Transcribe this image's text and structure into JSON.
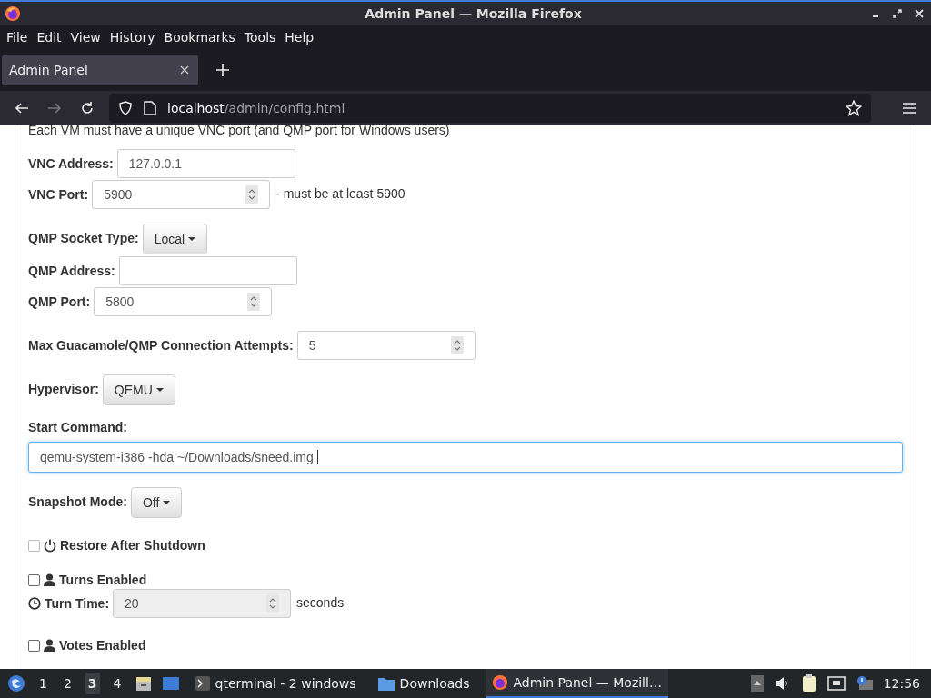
{
  "window": {
    "title": "Admin Panel — Mozilla Firefox"
  },
  "menu": [
    "File",
    "Edit",
    "View",
    "History",
    "Bookmarks",
    "Tools",
    "Help"
  ],
  "tabs": [
    {
      "label": "Admin Panel",
      "selected": true
    }
  ],
  "address": {
    "host": "localhost",
    "path": "/admin/config.html"
  },
  "sections": [
    [
      {
        "kind": "note",
        "text": "Each VM must have a unique VNC port (and QMP port for Windows users)"
      },
      {
        "kind": "text",
        "label": "VNC Address:",
        "value": "127.0.0.1"
      },
      {
        "kind": "number",
        "label": "VNC Port:",
        "value": "5900",
        "suffix": "- must be at least 5900"
      }
    ],
    [
      {
        "kind": "dropdown",
        "label": "QMP Socket Type:",
        "value": "Local"
      },
      {
        "kind": "text",
        "label": "QMP Address:"
      },
      {
        "kind": "number",
        "label": "QMP Port:",
        "value": "5800"
      }
    ],
    [
      {
        "kind": "number",
        "label": "Max Guacamole/QMP Connection Attempts:",
        "value": "5"
      }
    ],
    [
      {
        "kind": "dropdown",
        "label": "Hypervisor:",
        "value": "QEMU"
      }
    ],
    [
      {
        "kind": "wide",
        "label": "Start Command:",
        "value": "qemu-system-i386 -hda ~/Downloads/sneed.img",
        "focused": true
      }
    ],
    [
      {
        "kind": "dropdown",
        "label": "Snapshot Mode:",
        "value": "Off"
      }
    ],
    [
      {
        "kind": "checkbox",
        "label": "Restore After Shutdown",
        "checked": false,
        "disabled": true
      }
    ],
    [
      {
        "kind": "checkbox",
        "label": "Turns Enabled",
        "checked": false,
        "disabled": false
      },
      {
        "kind": "timer",
        "label": "Turn Time:",
        "value": "20",
        "suffix": "seconds",
        "disabled": true
      }
    ],
    [
      {
        "kind": "checkbox",
        "label": "Votes Enabled",
        "checked": false,
        "disabled": false
      }
    ]
  ],
  "taskbar": {
    "workspaces": [
      {
        "label": "1",
        "selected": false
      },
      {
        "label": "2",
        "selected": false
      },
      {
        "label": "3",
        "selected": true
      },
      {
        "label": "4",
        "selected": false
      }
    ],
    "tasks": [
      {
        "kind": "terminal",
        "label": "qterminal - 2 windows",
        "selected": false
      },
      {
        "kind": "folder",
        "label": "Downloads",
        "selected": false
      },
      {
        "kind": "browser",
        "label": "Admin Panel — Mozill…",
        "selected": true
      }
    ],
    "clock": "12:56"
  }
}
